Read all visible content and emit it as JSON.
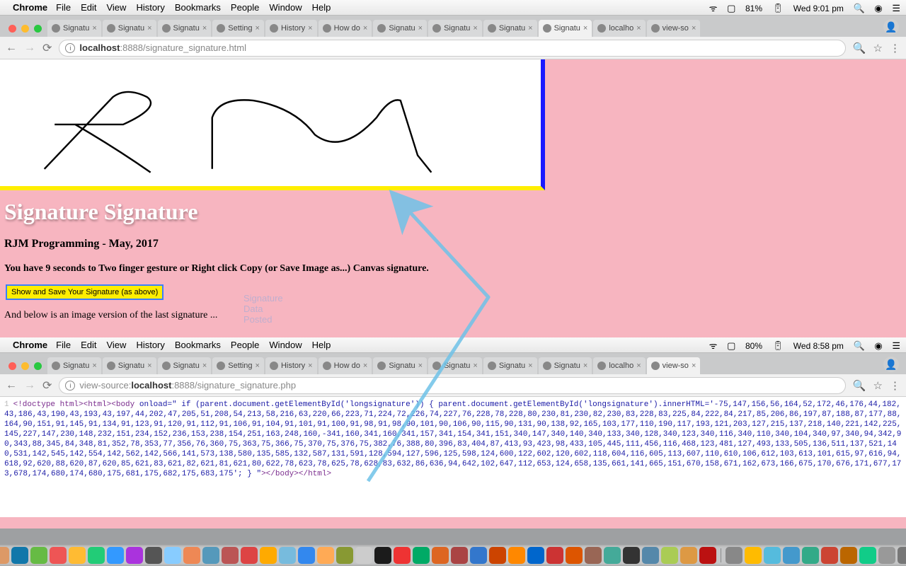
{
  "menubar_top": {
    "app": "Chrome",
    "items": [
      "File",
      "Edit",
      "View",
      "History",
      "Bookmarks",
      "People",
      "Window",
      "Help"
    ],
    "battery": "81%",
    "clock": "Wed 9:01 pm"
  },
  "menubar_bottom": {
    "app": "Chrome",
    "items": [
      "File",
      "Edit",
      "View",
      "History",
      "Bookmarks",
      "People",
      "Window",
      "Help"
    ],
    "battery": "80%",
    "clock": "Wed 8:58 pm"
  },
  "tabs_top": [
    {
      "label": "Signatu"
    },
    {
      "label": "Signatu"
    },
    {
      "label": "Signatu"
    },
    {
      "label": "Setting"
    },
    {
      "label": "History"
    },
    {
      "label": "How do"
    },
    {
      "label": "Signatu"
    },
    {
      "label": "Signatu"
    },
    {
      "label": "Signatu"
    },
    {
      "label": "Signatu",
      "active": true
    },
    {
      "label": "localho"
    },
    {
      "label": "view-so"
    }
  ],
  "tabs_bottom": [
    {
      "label": "Signatu"
    },
    {
      "label": "Signatu"
    },
    {
      "label": "Signatu"
    },
    {
      "label": "Setting"
    },
    {
      "label": "History"
    },
    {
      "label": "How do"
    },
    {
      "label": "Signatu"
    },
    {
      "label": "Signatu"
    },
    {
      "label": "Signatu"
    },
    {
      "label": "Signatu"
    },
    {
      "label": "localho"
    },
    {
      "label": "view-so",
      "active": true
    }
  ],
  "url_top": {
    "host": "localhost",
    "port": ":8888",
    "path": "/signature_signature.html"
  },
  "url_bottom": {
    "prefix": "view-source:",
    "host": "localhost",
    "port": ":8888",
    "path": "/signature_signature.php"
  },
  "page": {
    "title": "Signature Signature",
    "subtitle": "RJM Programming - May, 2017",
    "countdown": "You have 9 seconds to Two finger gesture or Right click Copy (or Save Image as...) Canvas signature.",
    "button": "Show and Save Your Signature (as above)",
    "below": "And below is an image version of the last signature ...",
    "faint": [
      "Signature",
      "Data",
      "Posted"
    ]
  },
  "source": {
    "head": "<!doctype html>",
    "body_open": "<html><body onload=\" if (parent.document.getElementById('longsignature')) { parent.document.getElementById('longsignature').innerHTML='",
    "coords": "-75,147,156,56,164,52,172,46,176,44,182,43,186,43,190,43,193,43,197,44,202,47,205,51,208,54,213,58,216,63,220,66,223,71,224,72,226,74,227,76,228,78,228,80,230,81,230,82,230,83,228,83,225,84,222,84,217,85,206,86,197,87,188,87,177,88,164,90,151,91,145,91,134,91,123,91,120,91,112,91,106,91,104,91,101,91,100,91,98,91,98,90,101,90,106,90,115,90,131,90,138,92,165,103,177,110,190,117,193,121,203,127,215,137,218,140,221,142,225,145,227,147,230,148,232,151,234,152,236,153,238,154,251,163,248,160,-341,160,341,160,341,157,341,154,341,151,340,147,340,140,340,133,340,128,340,123,340,116,340,110,340,104,340,97,340,94,342,90,343,88,345,84,348,81,352,78,353,77,356,76,360,75,363,75,366,75,370,75,376,75,382,76,388,80,396,83,404,87,413,93,423,98,433,105,445,111,456,116,468,123,481,127,493,133,505,136,511,137,521,140,531,142,545,142,554,142,562,142,566,141,573,138,580,135,585,132,587,131,591,128,594,127,596,125,598,124,600,122,602,120,602,118,604,116,605,113,607,110,610,106,612,103,613,101,615,97,616,94,618,92,620,88,620,87,620,85,621,83,621,82,621,81,621,80,622,78,623,78,625,78,628,83,632,86,636,94,642,102,647,112,653,124,658,135,661,141,665,151,670,158,671,162,673,166,675,170,676,171,677,173,678,174,680,174,680,175,681,175,682,175,683,175",
    "tail": "'; }  \"></body></html>"
  },
  "dock_colors": [
    "#2b6cb0",
    "#5aa",
    "#d96",
    "#17a",
    "#6b4",
    "#e55",
    "#fb3",
    "#2c7",
    "#39f",
    "#a3d",
    "#555",
    "#8cf",
    "#e85",
    "#59b",
    "#b55",
    "#d44",
    "#fa0",
    "#7bd",
    "#38e",
    "#fa5",
    "#893",
    "#ccc",
    "#1b1b1b",
    "#e33",
    "#0a6",
    "#d62",
    "#a44",
    "#37c",
    "#c40",
    "#f80",
    "#06c",
    "#c33",
    "#d50",
    "#965",
    "#4a9",
    "#333",
    "#58a",
    "#ac5",
    "#d94",
    "#b11",
    "#888",
    "#fb0",
    "#5bd",
    "#49c",
    "#3a8",
    "#c43",
    "#b60",
    "#1c8",
    "#999",
    "#777",
    "#fc3",
    "#3ad"
  ]
}
